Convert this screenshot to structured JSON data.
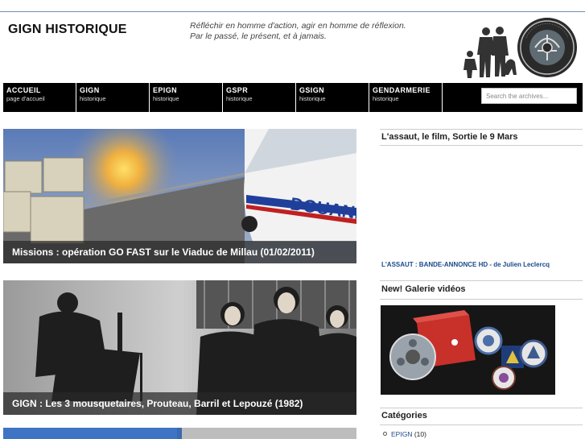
{
  "header": {
    "site_title": "GIGN HISTORIQUE",
    "tagline_1": "Réfléchir en homme d'action, agir en homme de réflexion.",
    "tagline_2": "Par le passé, le présent, et à jamais.",
    "logo_ring_text": "GROUPE D'INTERVENTION · GENDARMERIE NATIONALE"
  },
  "nav": {
    "items": [
      {
        "title": "ACCUEIL",
        "sub": "page d'accueil"
      },
      {
        "title": "GIGN",
        "sub": "historique"
      },
      {
        "title": "EPIGN",
        "sub": "historique"
      },
      {
        "title": "GSPR",
        "sub": "historique"
      },
      {
        "title": "GSIGN",
        "sub": "historique"
      },
      {
        "title": "GENDARMERIE",
        "sub": "historique"
      }
    ],
    "search_placeholder": "Search the archives..."
  },
  "posts": [
    {
      "caption": "Missions : opération GO FAST sur le Viaduc de Millau (01/02/2011)",
      "image_text": "DOUANE"
    },
    {
      "caption": "GIGN : Les 3 mousquetaires, Prouteau, Barril et Lepouzé (1982)"
    }
  ],
  "sidebar": {
    "film_heading": "L'assaut, le film, Sortie le 9 Mars",
    "trailer_link": "L'ASSAUT : BANDE-ANNONCE HD - de Julien Leclercq",
    "gallery_heading": "New! Galerie vidéos",
    "categories_heading": "Catégories",
    "categories": [
      {
        "name": "EPIGN",
        "count": "(10)"
      }
    ]
  },
  "colors": {
    "nav_bg": "#000000",
    "link": "#1a4a8a",
    "caption_bg": "#282828",
    "top_rule": "#6f8fb0"
  }
}
